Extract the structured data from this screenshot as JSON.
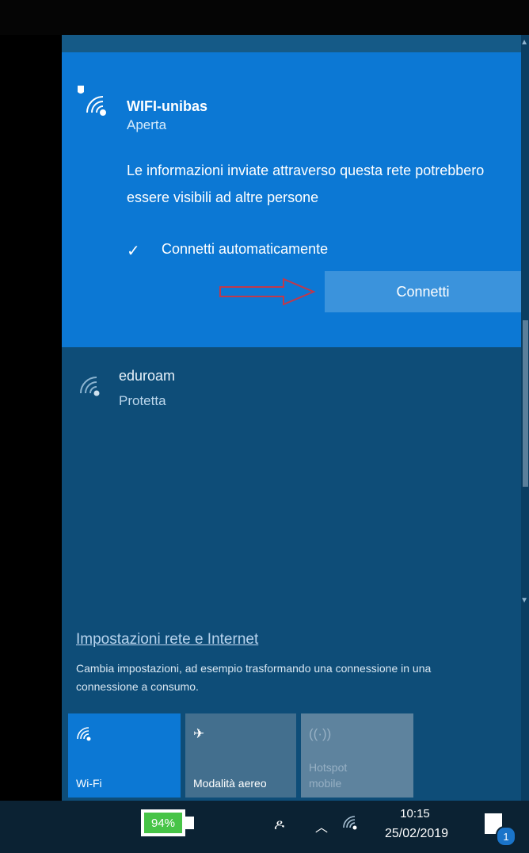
{
  "selected_network": {
    "name": "WIFI-unibas",
    "status": "Aperta",
    "warning": "Le informazioni inviate attraverso questa rete potrebbero essere visibili ad altre persone",
    "auto_connect_label": "Connetti automaticamente",
    "auto_connect_checked": true,
    "connect_button": "Connetti"
  },
  "other_networks": [
    {
      "name": "eduroam",
      "status": "Protetta"
    }
  ],
  "settings": {
    "link": "Impostazioni rete e Internet",
    "description": "Cambia impostazioni, ad esempio trasformando una connessione in una connessione a consumo."
  },
  "quick_actions": [
    {
      "label": "Wi-Fi",
      "icon": "wifi-icon",
      "state": "on"
    },
    {
      "label": "Modalità aereo",
      "icon": "airplane-icon",
      "state": "off"
    },
    {
      "label_line1": "Hotspot",
      "label_line2": "mobile",
      "icon": "hotspot-icon",
      "state": "disabled"
    }
  ],
  "taskbar": {
    "battery": "94%",
    "time": "10:15",
    "date": "25/02/2019",
    "notification_count": "1"
  },
  "colors": {
    "accent": "#0c78d4",
    "flyout_bg": "#0e4d78",
    "taskbar_bg": "#0b2233",
    "arrow_annotation": "#c0394b"
  }
}
